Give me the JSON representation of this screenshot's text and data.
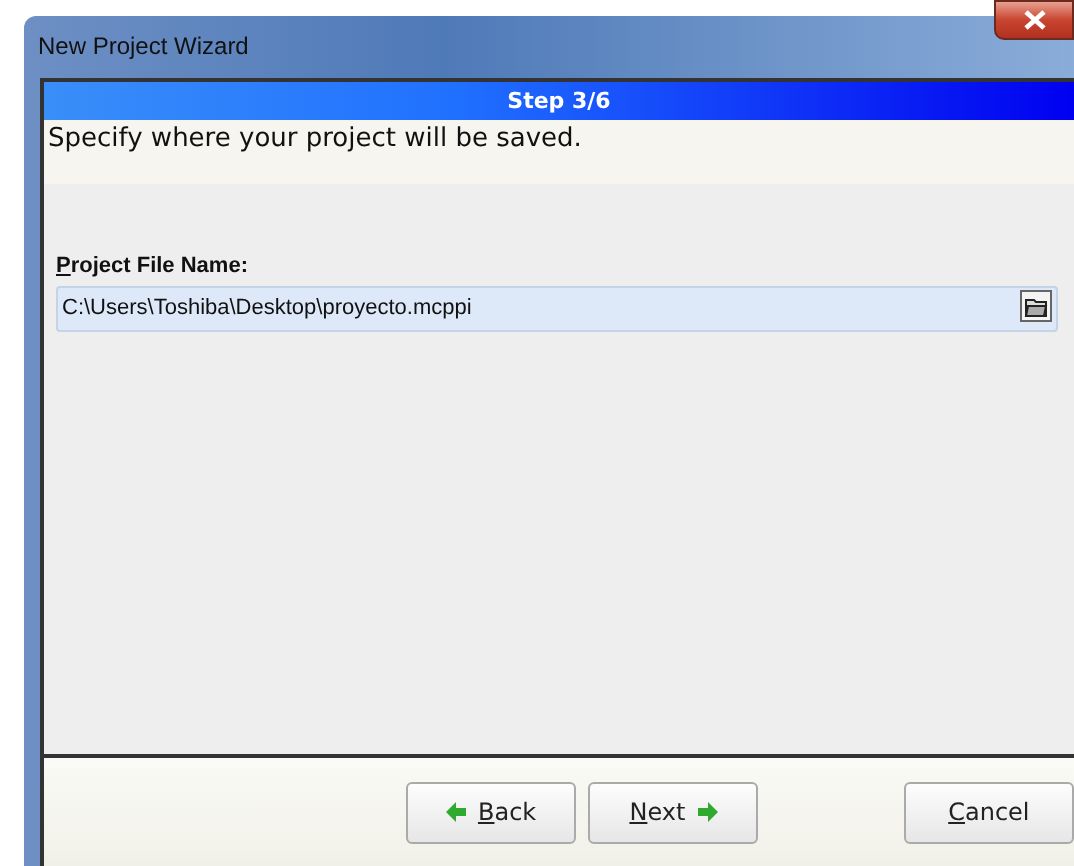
{
  "window": {
    "title": "New Project Wizard"
  },
  "step": {
    "title": "Step 3/6",
    "instruction": "Specify where your project will be saved."
  },
  "project_file": {
    "label": "Project File Name:",
    "value": "C:\\Users\\Toshiba\\Desktop\\proyecto.mcppi"
  },
  "buttons": [
    {
      "label": "Back",
      "kind": "back"
    },
    {
      "label": "Next",
      "kind": "next"
    },
    {
      "label": "Cancel",
      "kind": "cancel"
    }
  ]
}
